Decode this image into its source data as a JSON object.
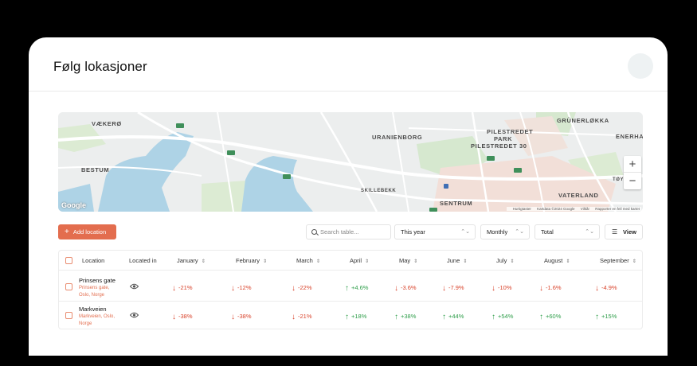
{
  "page": {
    "title": "Følg lokasjoner"
  },
  "map": {
    "labels": [
      "VÆKERØ",
      "BESTUM",
      "URANIENBORG",
      "PILESTREDET",
      "PARK",
      "PILESTREDET 30",
      "GRÜNERLØKKA",
      "ENERHAU",
      "VATERLAND",
      "SKILLEBEKK",
      "SENTRUM",
      "TØYE"
    ],
    "zoom_in": "+",
    "zoom_out": "−",
    "google": "Google",
    "attribution": [
      "Hurtigtaster",
      "Kartdata ©2024 Google",
      "Vilkår",
      "Rapporter en feil med kartet"
    ]
  },
  "toolbar": {
    "add_label": "Add location",
    "add_icon": "+",
    "search_placeholder": "Search table...",
    "period": "This year",
    "interval": "Monthly",
    "aggregate": "Total",
    "view_label": "View"
  },
  "table": {
    "headers": {
      "location": "Location",
      "located_in": "Located in",
      "months": [
        "January",
        "February",
        "March",
        "April",
        "May",
        "June",
        "July",
        "August",
        "September"
      ]
    },
    "rows": [
      {
        "name": "Prinsens gate",
        "address": "Prinsens gate, Oslo, Norge",
        "values": [
          {
            "text": "-21%",
            "dir": "down"
          },
          {
            "text": "-12%",
            "dir": "down"
          },
          {
            "text": "-22%",
            "dir": "down"
          },
          {
            "text": "+4.6%",
            "dir": "up"
          },
          {
            "text": "-3.6%",
            "dir": "down"
          },
          {
            "text": "-7.9%",
            "dir": "down"
          },
          {
            "text": "-10%",
            "dir": "down"
          },
          {
            "text": "-1.6%",
            "dir": "down"
          },
          {
            "text": "-4.9%",
            "dir": "down"
          }
        ]
      },
      {
        "name": "Markveien",
        "address": "Markveien, Oslo, Norge",
        "values": [
          {
            "text": "-38%",
            "dir": "down"
          },
          {
            "text": "-38%",
            "dir": "down"
          },
          {
            "text": "-21%",
            "dir": "down"
          },
          {
            "text": "+18%",
            "dir": "up"
          },
          {
            "text": "+38%",
            "dir": "up"
          },
          {
            "text": "+44%",
            "dir": "up"
          },
          {
            "text": "+54%",
            "dir": "up"
          },
          {
            "text": "+60%",
            "dir": "up"
          },
          {
            "text": "+15%",
            "dir": "up"
          }
        ]
      }
    ]
  },
  "colors": {
    "accent": "#e36d4e",
    "negative": "#d9432b",
    "positive": "#2e9e4a"
  }
}
